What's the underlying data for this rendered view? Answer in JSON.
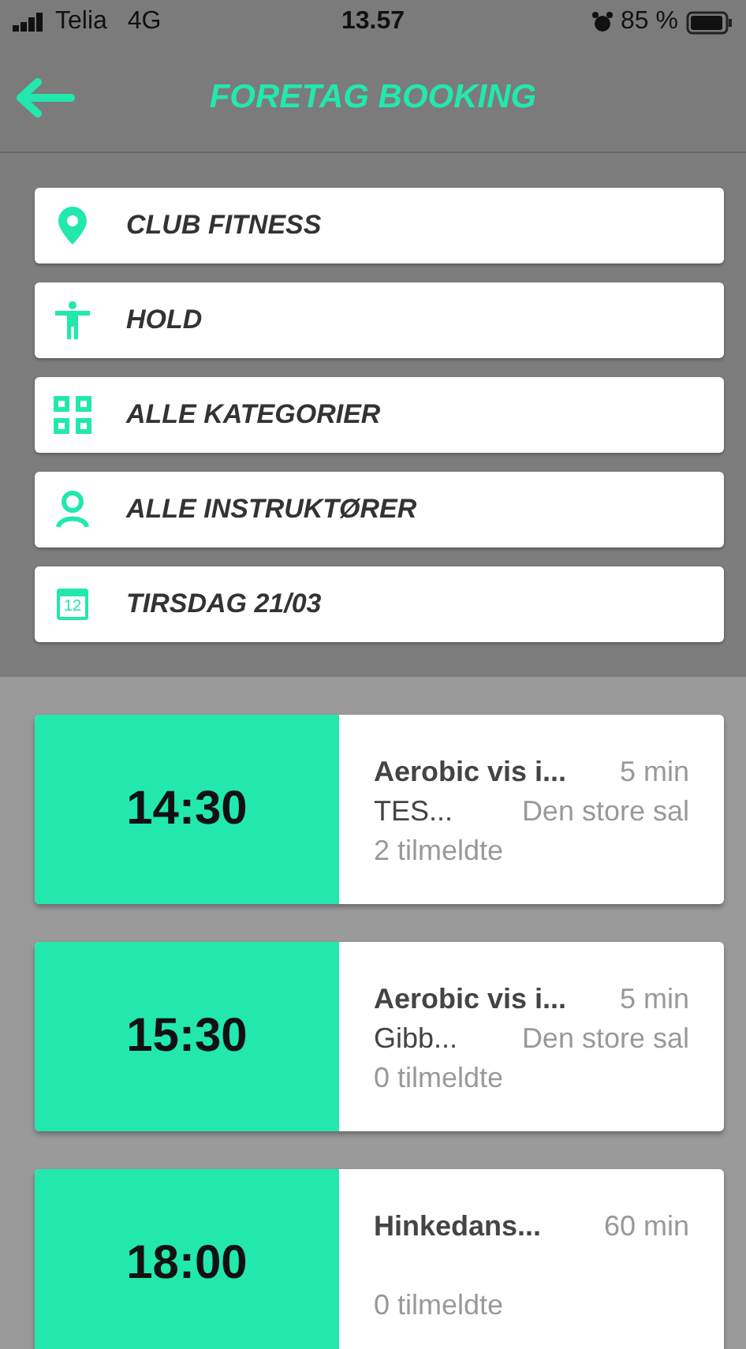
{
  "status_bar": {
    "carrier": "Telia",
    "network": "4G",
    "time": "13.57",
    "battery": "85 %"
  },
  "header": {
    "title": "FORETAG BOOKING"
  },
  "filters": [
    {
      "kind": "location",
      "label": "CLUB FITNESS"
    },
    {
      "kind": "person",
      "label": "HOLD"
    },
    {
      "kind": "grid",
      "label": "ALLE KATEGORIER"
    },
    {
      "kind": "user",
      "label": "ALLE INSTRUKTØRER"
    },
    {
      "kind": "calendar",
      "label": "TIRSDAG 21/03",
      "icon_text": "12"
    }
  ],
  "classes": [
    {
      "time": "14:30",
      "title": "Aerobic vis i...",
      "duration": "5 min",
      "instructor": "TES...",
      "room": "Den store sal",
      "signups": "2 tilmeldte"
    },
    {
      "time": "15:30",
      "title": "Aerobic vis i...",
      "duration": "5 min",
      "instructor": "Gibb...",
      "room": "Den store sal",
      "signups": "0 tilmeldte"
    },
    {
      "time": "18:00",
      "title": "Hinkedans...",
      "duration": "60 min",
      "signups": "0 tilmeldte"
    }
  ]
}
